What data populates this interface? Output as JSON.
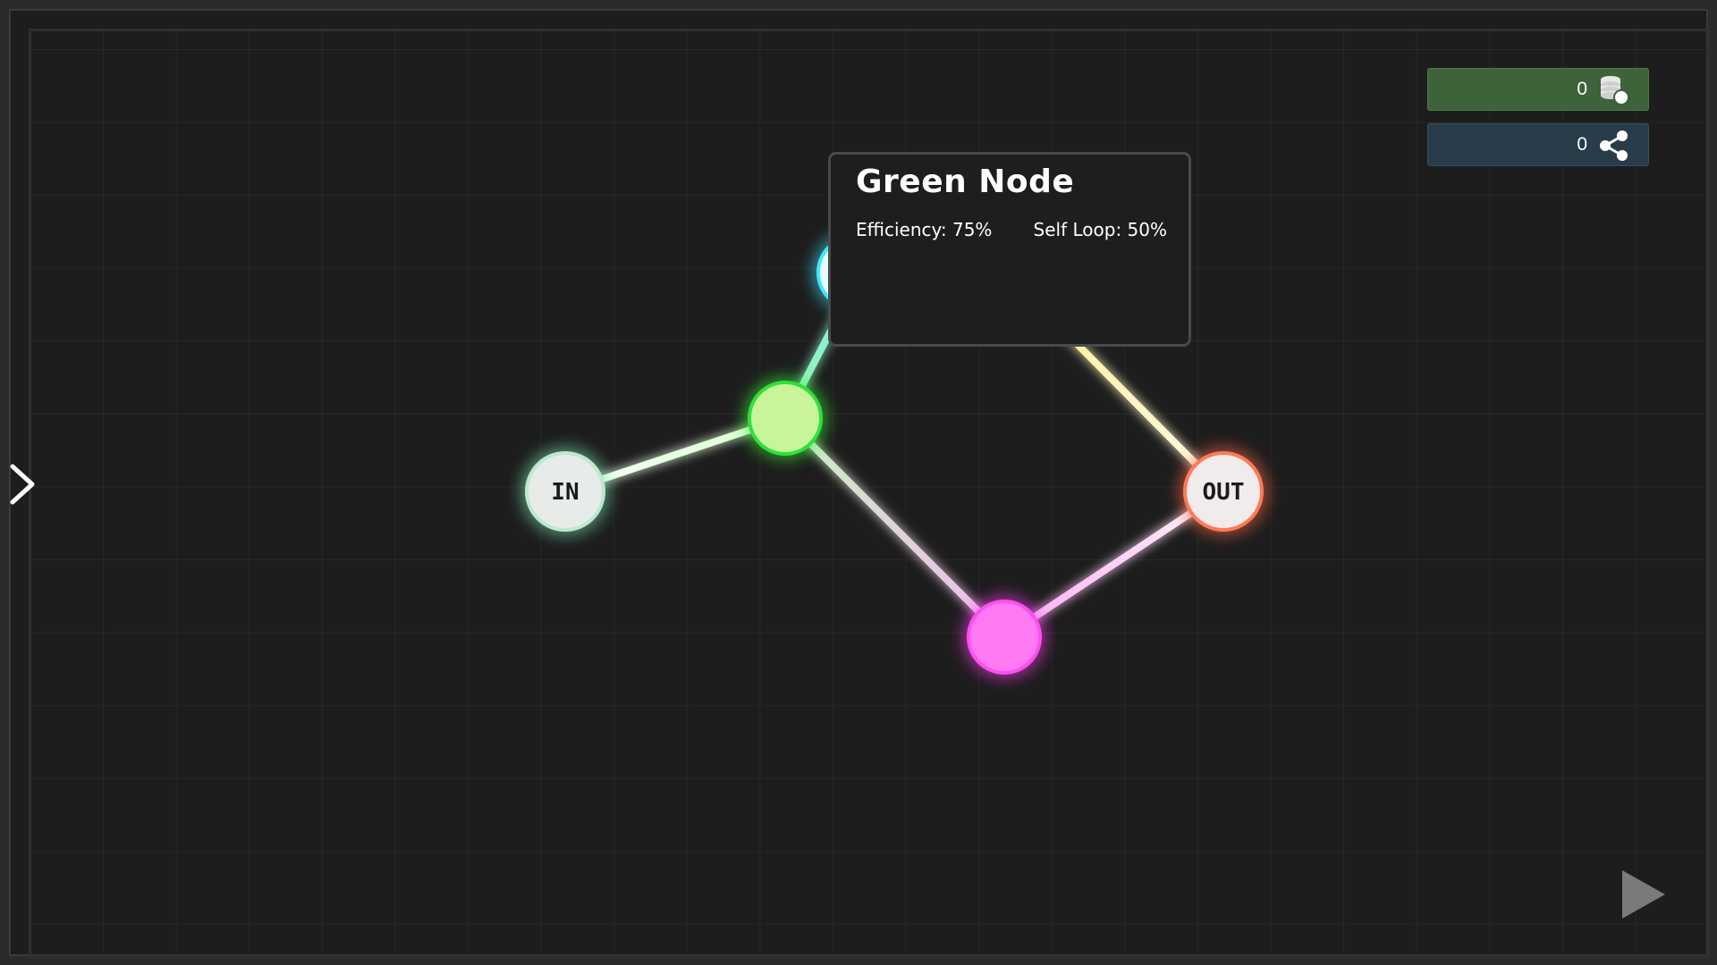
{
  "nodes": [
    {
      "name": "in-node",
      "label": "IN",
      "color": "#e8ece9",
      "glow": "#7de8b0",
      "ring": "#bfe8cf"
    },
    {
      "name": "green-node",
      "label": "",
      "color": "#c8f59a",
      "glow": "#3ef23a",
      "ring": "#2fe03a"
    },
    {
      "name": "cyan-node",
      "label": "",
      "color": "#e4fbff",
      "glow": "#43e6ff",
      "ring": "#43e6ff"
    },
    {
      "name": "magenta-node",
      "label": "",
      "color": "#ff7af2",
      "glow": "#ff3df0",
      "ring": "#ff4ff0"
    },
    {
      "name": "out-node",
      "label": "OUT",
      "color": "#f1eceb",
      "glow": "#ff6b4a",
      "ring": "#ff7a57"
    }
  ],
  "hud": {
    "coins_value": "0",
    "shares_value": "0",
    "coins_icon": "coin-stack-icon",
    "shares_icon": "share-icon"
  },
  "tooltip": {
    "title": "Green Node",
    "efficiency": "Efficiency: 75%",
    "self_loop": "Self Loop: 50%"
  },
  "controls": {
    "side_toggle_icon": "chevron-right-icon",
    "play_icon": "play-icon"
  }
}
